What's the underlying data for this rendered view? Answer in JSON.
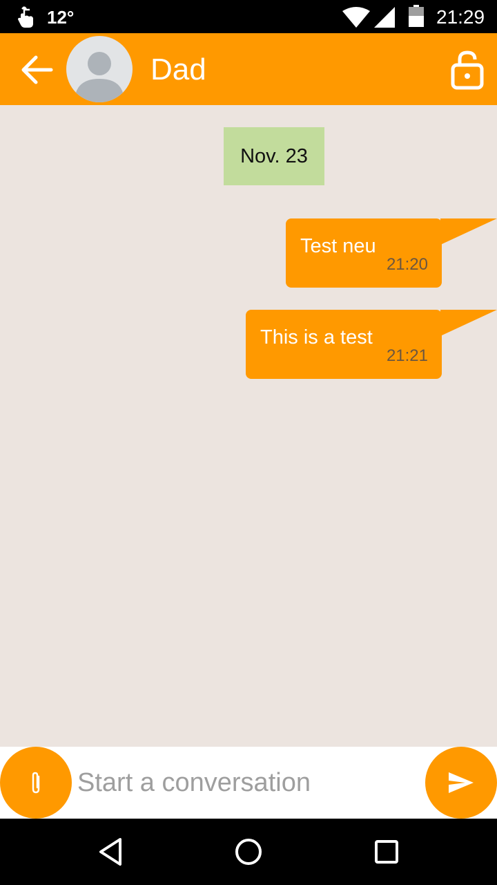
{
  "status_bar": {
    "temperature": "12°",
    "time": "21:29",
    "icons": [
      "touch-icon",
      "wifi-icon",
      "signal-icon",
      "battery-icon"
    ]
  },
  "header": {
    "contact_name": "Dad",
    "icons": [
      "back-arrow-icon",
      "avatar-placeholder-icon",
      "unlocked-lock-icon"
    ],
    "accent_color": "#ff9900"
  },
  "conversation": {
    "date_divider": "Nov. 23",
    "messages": [
      {
        "text": "Test neu",
        "time": "21:20",
        "direction": "outgoing"
      },
      {
        "text": "This is a test",
        "time": "21:21",
        "direction": "outgoing"
      }
    ],
    "background_color": "#ece4df",
    "date_chip_color": "#c2dc9c"
  },
  "composer": {
    "placeholder": "Start a conversation",
    "value": "",
    "icons": [
      "paperclip-icon",
      "send-icon"
    ]
  },
  "navigation": {
    "icons": [
      "back-triangle-icon",
      "home-circle-icon",
      "recents-square-icon"
    ]
  }
}
